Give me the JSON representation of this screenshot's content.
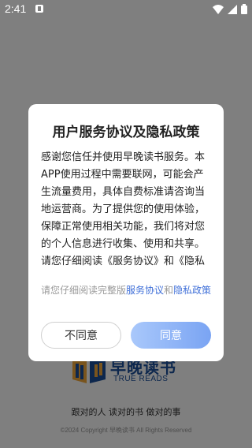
{
  "status_bar": {
    "time": "2:41",
    "icons": [
      "notification-icon",
      "wifi-icon",
      "signal-icon",
      "battery-icon"
    ]
  },
  "splash": {
    "logo_title": "早晚读书",
    "logo_subtitle": "TRUE READS",
    "slogan": "跟对的人 读对的书 做对的事",
    "copyright": "©2024 Copyright 早晚读书 All Rights Reserved"
  },
  "dialog": {
    "title": "用户服务协议及隐私政策",
    "body": "感谢您信任并使用早晚读书服务。本APP使用过程中需要联网，可能会产生流量费用，具体自费标准请咨询当地运营商。为了提供您的使用体验，保障正常使用相关功能，我们将对您的个人信息进行收集、使用和共享。请您仔细阅读《服务协议》和《隐私政策》，并确认了解我们对您个人信息的处理规则。",
    "notice_prefix": "请您仔细阅读完整版",
    "service_link": "服务协议",
    "notice_and": "和",
    "privacy_link": "隐私政策",
    "disagree_label": "不同意",
    "agree_label": "同意"
  },
  "colors": {
    "link": "#3f6fd8",
    "brand": "#1b4f9a",
    "agree_start": "#a9c8fb",
    "agree_end": "#7aa4f3"
  }
}
